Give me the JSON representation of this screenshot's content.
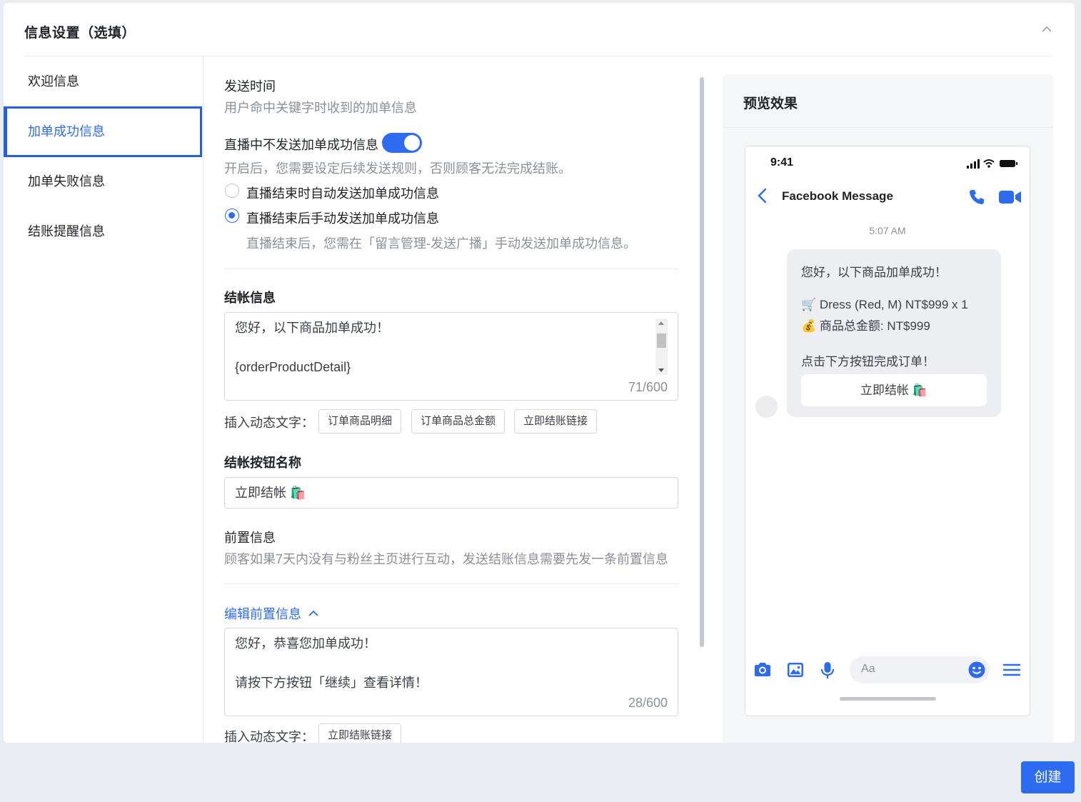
{
  "card": {
    "title": "信息设置（选填）"
  },
  "sidebar": {
    "items": [
      {
        "label": "欢迎信息"
      },
      {
        "label": "加单成功信息"
      },
      {
        "label": "加单失败信息"
      },
      {
        "label": "结账提醒信息"
      }
    ],
    "active_index": 1
  },
  "form": {
    "send_time": {
      "label": "发送时间",
      "hint": "用户命中关键字时收到的加单信息"
    },
    "live_toggle": {
      "label": "直播中不发送加单成功信息",
      "on": true,
      "hint": "开启后，您需要设定后续发送规则，否则顾客无法完成结账。"
    },
    "radios": [
      {
        "label": "直播结束时自动发送加单成功信息",
        "checked": false
      },
      {
        "label": "直播结束后手动发送加单成功信息",
        "checked": true
      }
    ],
    "radio_hint": "直播结束后，您需在「留言管理-发送广播」手动发送加单成功信息。",
    "checkout_message": {
      "label": "结帐信息",
      "line1": "您好，以下商品加单成功！",
      "line2": "{orderProductDetail}",
      "count": "71/600"
    },
    "insert_label": "插入动态文字：",
    "insert_chips": [
      "订单商品明细",
      "订单商品总金额",
      "立即结账链接"
    ],
    "button_name": {
      "label": "结帐按钮名称",
      "value": "立即结帐 🛍️"
    },
    "pre_message": {
      "label": "前置信息",
      "hint": "顾客如果7天内没有与粉丝主页进行互动，发送结账信息需要先发一条前置信息",
      "edit_link": "编辑前置信息",
      "line1": "您好，恭喜您加单成功！",
      "line2": "请按下方按钮「继续」查看详情！",
      "count": "28/600"
    },
    "insert_label_2": "插入动态文字：",
    "insert_chips_2": [
      "立即结账链接"
    ]
  },
  "preview": {
    "title": "预览效果",
    "status_time": "9:41",
    "messenger_title": "Facebook Message",
    "msg_time": "5:07 AM",
    "bubble": {
      "line1": "您好，以下商品加单成功！",
      "line2": "🛒 Dress (Red, M) NT$999 x 1",
      "line3": "💰 商品总金额: NT$999",
      "line4": "点击下方按钮完成订单！",
      "button": "立即结帐 🛍️"
    },
    "compose_placeholder": "Aa",
    "icons": [
      "back-arrow-icon",
      "phone-icon",
      "video-icon",
      "camera-icon",
      "image-icon",
      "mic-icon",
      "emoji-icon",
      "menu-icon"
    ]
  },
  "footer": {
    "create_label": "创建"
  },
  "colors": {
    "accent": "#2d6cf0",
    "page_bg": "#e9ecf1"
  }
}
